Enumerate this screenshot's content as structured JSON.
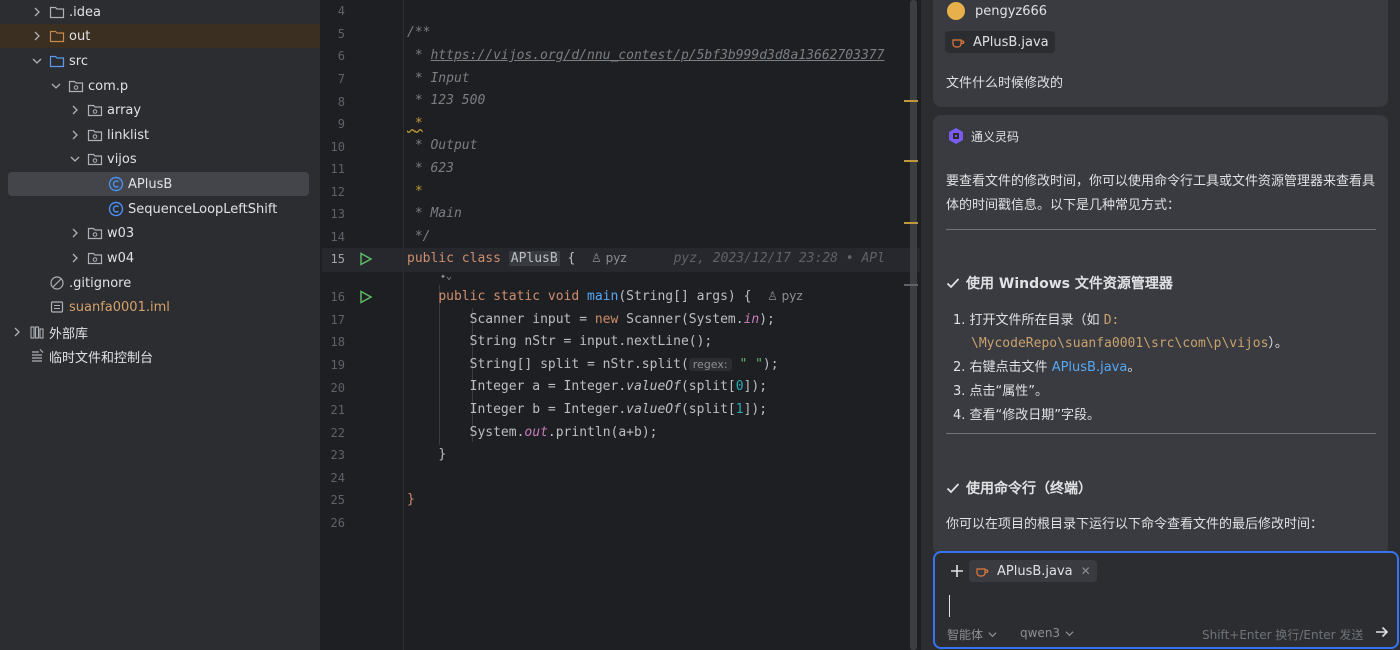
{
  "project_tree": {
    "items": [
      {
        "label": ".idea",
        "type": "folder",
        "expanded": false
      },
      {
        "label": "out",
        "type": "folder-orange",
        "expanded": false
      },
      {
        "label": "src",
        "type": "folder-blue",
        "expanded": true
      },
      {
        "label": "com.p",
        "type": "package",
        "expanded": true
      },
      {
        "label": "array",
        "type": "package",
        "expanded": false
      },
      {
        "label": "linklist",
        "type": "package",
        "expanded": false
      },
      {
        "label": "vijos",
        "type": "package",
        "expanded": true
      },
      {
        "label": "APlusB",
        "type": "java-class"
      },
      {
        "label": "SequenceLoopLeftShift",
        "type": "java-class"
      },
      {
        "label": "w03",
        "type": "package",
        "expanded": false
      },
      {
        "label": "w04",
        "type": "package",
        "expanded": false
      },
      {
        "label": ".gitignore",
        "type": "file"
      },
      {
        "label": "suanfa0001.iml",
        "type": "file-iml"
      },
      {
        "label": "外部库",
        "type": "library",
        "expanded": false
      },
      {
        "label": "临时文件和控制台",
        "type": "scratch"
      }
    ]
  },
  "editor": {
    "line_numbers": [
      "4",
      "5",
      "6",
      "7",
      "8",
      "9",
      "10",
      "11",
      "12",
      "13",
      "14",
      "15",
      "16",
      "17",
      "18",
      "19",
      "20",
      "21",
      "22",
      "23",
      "24",
      "25",
      "26"
    ],
    "current_line": "15",
    "comment": {
      "open": "/**",
      "url": "https://vijos.org/d/nnu_contest/p/5bf3b999d3d8a13662703377",
      "input_label": "* Input",
      "input_value": "* 123 500",
      "star": "*",
      "output_label": "* Output",
      "output_value": "* 623",
      "main_label": "* Main",
      "close": "*/"
    },
    "class_decl": {
      "kw": "public class ",
      "name": "APlusB",
      "brace": " {"
    },
    "author": "pyz",
    "blame": "pyz, 2023/12/17 23:28 • APl",
    "main_decl": {
      "kw": "public static void ",
      "name": "main",
      "params": "(String[] args) {"
    },
    "lines": {
      "scanner": {
        "a": "Scanner input = ",
        "new": "new",
        "b": " Scanner(System.",
        "in": "in",
        "c": ");"
      },
      "nstr": "String nStr = input.nextLine();",
      "split": {
        "a": "String[] split = nStr.split(",
        "hint": "regex:",
        "str": "\" \"",
        "c": ");"
      },
      "int_a": {
        "a": "Integer a = Integer.",
        "fn": "valueOf",
        "b": "(split[",
        "n": "0",
        "c": "]);"
      },
      "int_b": {
        "a": "Integer b = Integer.",
        "fn": "valueOf",
        "b": "(split[",
        "n": "1",
        "c": "]);"
      },
      "println": {
        "a": "System.",
        "out": "out",
        "b": ".println(a+b);"
      },
      "close_inner": "}",
      "close_outer": "}"
    }
  },
  "ai_panel": {
    "user_name": "pengyz666",
    "attached_file": "APlusB.java",
    "question": "文件什么时候修改的",
    "assistant_name": "通义灵码",
    "intro": "要查看文件的修改时间，你可以使用命令行工具或文件资源管理器来查看具体的时间戳信息。以下是几种常见方式：",
    "section1_title": "使用 Windows 文件资源管理器",
    "steps": [
      {
        "num": "1.",
        "pre": "打开文件所在目录（如 ",
        "code1": "D:",
        "code2": "\\MycodeRepo\\suanfa0001\\src\\com\\p\\vijos",
        "post": "）。"
      },
      {
        "num": "2.",
        "pre": "右键点击文件 ",
        "link": "APlusB.java",
        "post": "。"
      },
      {
        "num": "3.",
        "text": "点击“属性”。"
      },
      {
        "num": "4.",
        "text": "查看“修改日期”字段。"
      }
    ],
    "section2_title": "使用命令行（终端）",
    "section2_text": "你可以在项目的根目录下运行以下命令查看文件的最后修改时间：",
    "input": {
      "attached_file": "APlusB.java",
      "agent_mode": "智能体",
      "model": "qwen3",
      "hint": "Shift+Enter 换行/Enter 发送"
    }
  },
  "colors": {
    "accent": "#3574f0",
    "keyword": "#cf8e6d",
    "function": "#56a8f5",
    "string": "#6aab73"
  }
}
